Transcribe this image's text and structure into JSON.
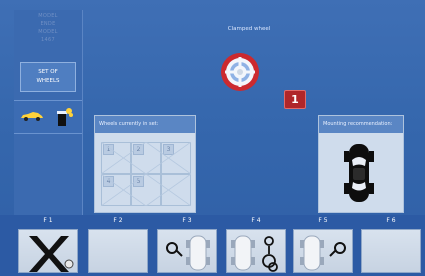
{
  "sidebar": {
    "model_lines": [
      "MODEL",
      "ENDE",
      "MODEL",
      "1467"
    ],
    "set_button": "SET OF\nWHEELS",
    "car_icon": "car-side-icon",
    "tools_icon": "clamp-tool-icon"
  },
  "main": {
    "clamped_wheels_title": "Clamped wheel",
    "clamp_icon": "wheel-clamp-target-icon",
    "badge_count": "1",
    "wheels_panel": {
      "title": "Wheels currently in set:",
      "cells": [
        "1",
        "2",
        "3",
        "4",
        "5",
        ""
      ]
    },
    "mount_panel": {
      "title": "Mounting recommendation:",
      "icon": "car-top-view-icon"
    }
  },
  "function_keys": [
    {
      "label": "F 1",
      "icon": "exit-x-icon"
    },
    {
      "label": "F 2",
      "icon": ""
    },
    {
      "label": "F 3",
      "icon": "rotate-wheel-left-icon"
    },
    {
      "label": "F 4",
      "icon": "wheel-clamp-adjust-icon"
    },
    {
      "label": "F 5",
      "icon": "rotate-wheel-right-icon"
    },
    {
      "label": "F 6",
      "icon": ""
    }
  ],
  "colors": {
    "background": "#3567ad",
    "badge": "#b0262a",
    "panel": "#cfdcec",
    "function_button": "#cfd9e6"
  }
}
